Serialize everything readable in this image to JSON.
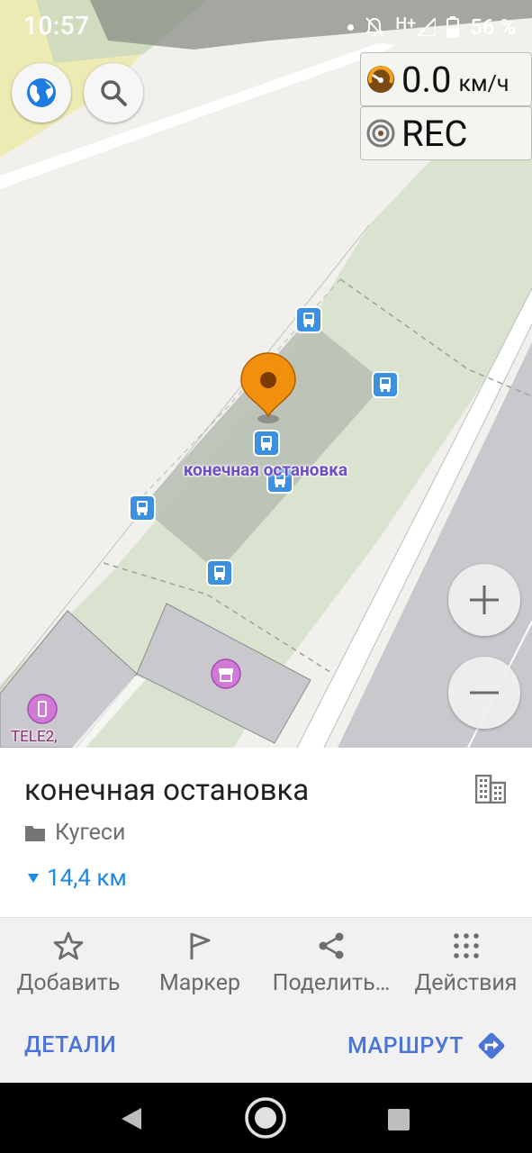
{
  "status_bar": {
    "time": "10:57",
    "network": "H+",
    "battery": "56 %"
  },
  "map": {
    "speed_value": "0.0",
    "speed_unit": "км/ч",
    "rec_label": "REC",
    "stop_label": "конечная остановка",
    "poi_label": "TELE2,",
    "colors": {
      "park": "#d6e5cd",
      "road": "#ffffff",
      "building": "#c9c8cd",
      "pin": "#f0900c",
      "bus_stop": "#3d8fe0"
    }
  },
  "place": {
    "title": "конечная остановка",
    "folder": "Кугеси",
    "distance": "14,4 км"
  },
  "actions": [
    {
      "label": "Добавить",
      "icon": "star-icon"
    },
    {
      "label": "Маркер",
      "icon": "flag-icon"
    },
    {
      "label": "Поделить…",
      "icon": "share-icon"
    },
    {
      "label": "Действия",
      "icon": "more-dots-icon"
    }
  ],
  "links": {
    "details": "ДЕТАЛИ",
    "route": "МАРШРУТ"
  }
}
